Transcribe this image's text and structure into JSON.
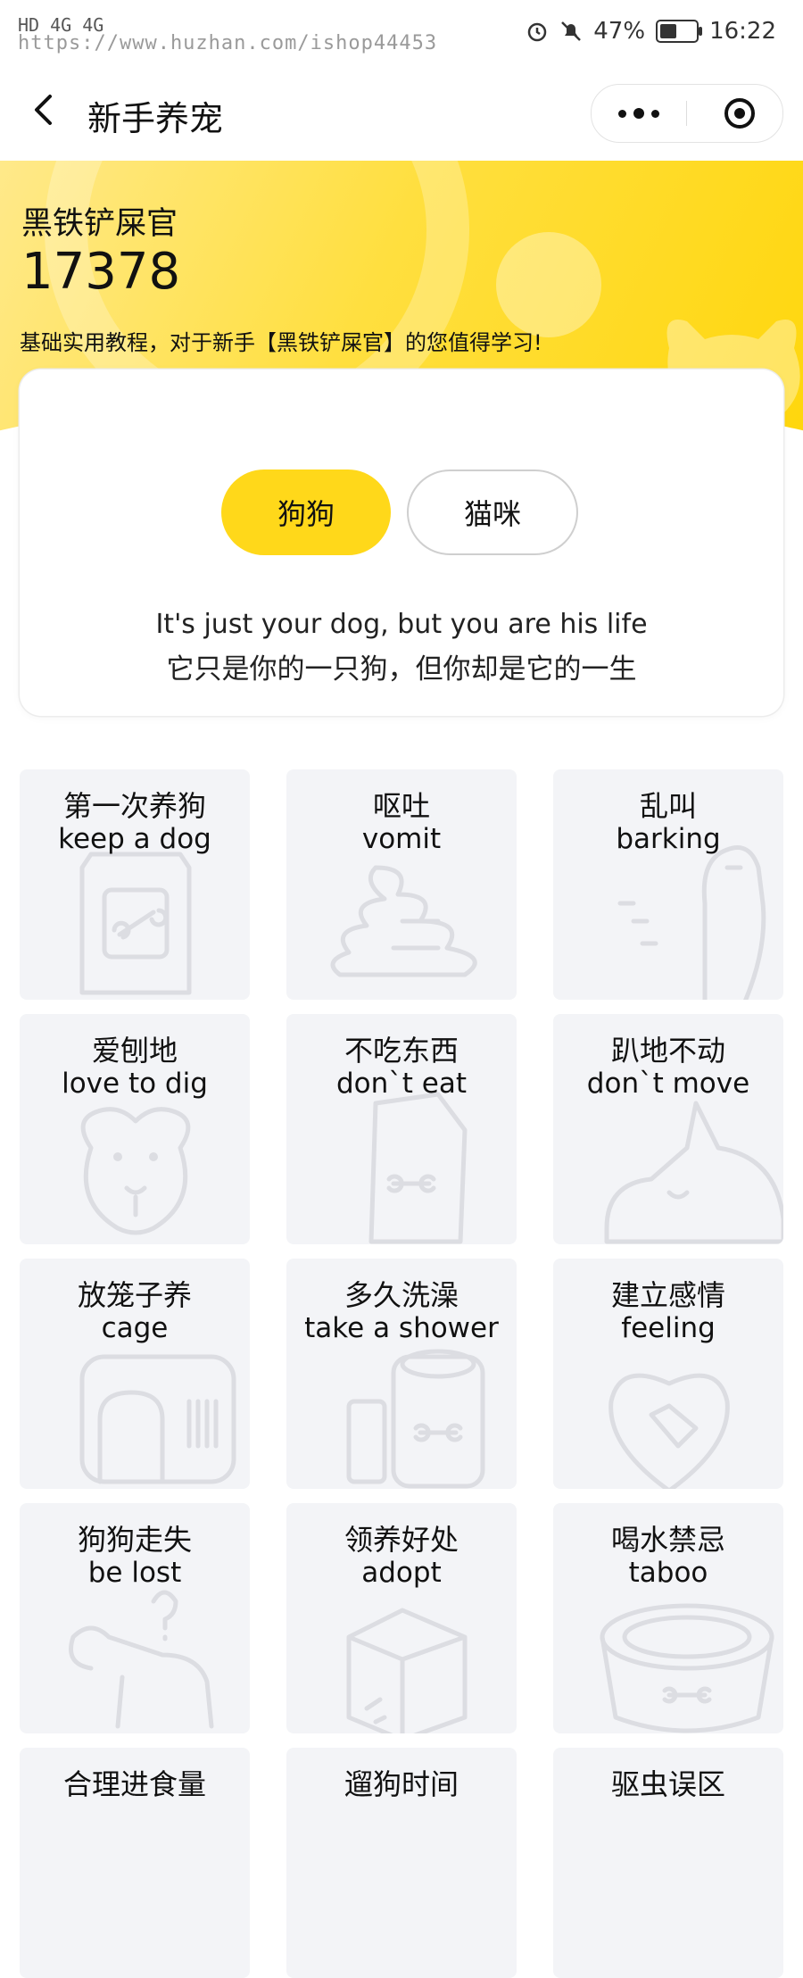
{
  "status_bar": {
    "left_icons": "HD 4G 4G",
    "watermark": "https://www.huzhan.com/ishop44453",
    "battery": "47%",
    "battery_level": 0.47,
    "time": "16:22"
  },
  "nav": {
    "title": "新手养宠"
  },
  "hero": {
    "user_name": "黑铁铲屎官",
    "count": "17378",
    "description": "基础实用教程，对于新手【黑铁铲屎官】的您值得学习!"
  },
  "tabs": [
    {
      "label": "狗狗",
      "selected": true
    },
    {
      "label": "猫咪",
      "selected": false
    }
  ],
  "quote": {
    "en": "It's just your dog, but you are his life",
    "cn": "它只是你的一只狗，但你却是它的一生"
  },
  "topics": [
    {
      "cn": "第一次养狗",
      "en": "keep a dog",
      "icon": "dog-food-bag-icon"
    },
    {
      "cn": "呕吐",
      "en": "vomit",
      "icon": "vomit-puddle-icon"
    },
    {
      "cn": "乱叫",
      "en": "barking",
      "icon": "barking-dog-icon"
    },
    {
      "cn": "爱刨地",
      "en": "love to dig",
      "icon": "dog-face-icon"
    },
    {
      "cn": "不吃东西",
      "en": "don`t eat",
      "icon": "food-bag-icon"
    },
    {
      "cn": "趴地不动",
      "en": "don`t move",
      "icon": "lying-dog-icon"
    },
    {
      "cn": "放笼子养",
      "en": "cage",
      "icon": "pet-carrier-icon"
    },
    {
      "cn": "多久洗澡",
      "en": "take a shower",
      "icon": "bath-supplies-icon"
    },
    {
      "cn": "建立感情",
      "en": "feeling",
      "icon": "heart-handshake-icon"
    },
    {
      "cn": "狗狗走失",
      "en": "be lost",
      "icon": "lost-dog-icon"
    },
    {
      "cn": "领养好处",
      "en": "adopt",
      "icon": "box-icon"
    },
    {
      "cn": "喝水禁忌",
      "en": "taboo",
      "icon": "water-bowl-icon"
    },
    {
      "cn": "合理进食量",
      "en": "",
      "icon": "food-icon"
    },
    {
      "cn": "遛狗时间",
      "en": "",
      "icon": "walk-icon"
    },
    {
      "cn": "驱虫误区",
      "en": "",
      "icon": "deworm-icon"
    }
  ]
}
